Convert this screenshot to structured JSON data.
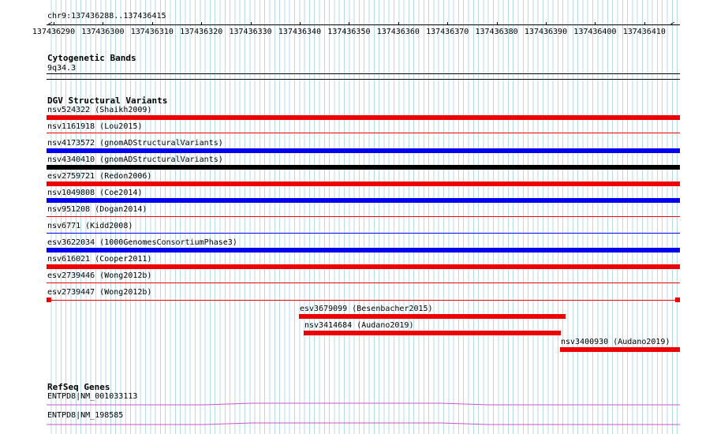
{
  "colors": {
    "red": "#ee0000",
    "blue": "#0000ee",
    "black": "#000000",
    "gene": "#cc55cc",
    "grid": "#b7dbe7"
  },
  "ruler": {
    "location": "chr9:137436288..137436415",
    "ticks": [
      "137436290",
      "137436300",
      "137436310",
      "137436320",
      "137436330",
      "137436340",
      "137436350",
      "137436360",
      "137436370",
      "137436380",
      "137436390",
      "137436400",
      "137436410"
    ],
    "arrow_glyph": "<"
  },
  "cytoband": {
    "title": "Cytogenetic Bands",
    "band": "9q34.3"
  },
  "dgv": {
    "title": "DGV Structural Variants",
    "variants": [
      {
        "label": "nsv524322 (Shaikh2009)",
        "color": "red",
        "style": "bar"
      },
      {
        "label": "nsv1161918 (Lou2015)",
        "color": "red",
        "style": "thin"
      },
      {
        "label": "nsv4173572 (gnomADStructuralVariants)",
        "color": "blue",
        "style": "bar"
      },
      {
        "label": "nsv4340410 (gnomADStructuralVariants)",
        "color": "black",
        "style": "bar"
      },
      {
        "label": "esv2759721 (Redon2006)",
        "color": "red",
        "style": "bar"
      },
      {
        "label": "nsv1049808 (Coe2014)",
        "color": "blue",
        "style": "bar"
      },
      {
        "label": "nsv951208 (Dogan2014)",
        "color": "red",
        "style": "thin"
      },
      {
        "label": "nsv6771 (Kidd2008)",
        "color": "blue",
        "style": "thin"
      },
      {
        "label": "esv3622034 (1000GenomesConsortiumPhase3)",
        "color": "blue",
        "style": "bar"
      },
      {
        "label": "nsv616021 (Cooper2011)",
        "color": "red",
        "style": "bar"
      },
      {
        "label": "esv2739446 (Wong2012b)",
        "color": "red",
        "style": "thin"
      },
      {
        "label": "esv2739447 (Wong2012b)",
        "color": "red",
        "style": "ends"
      },
      {
        "label": "esv3679099 (Besenbacher2015)",
        "color": "red",
        "style": "bar"
      },
      {
        "label": "nsv3414684 (Audano2019)",
        "color": "red",
        "style": "bar"
      },
      {
        "label": "nsv3400930 (Audano2019)",
        "color": "red",
        "style": "bar"
      }
    ]
  },
  "refseq": {
    "title": "RefSeq Genes",
    "genes": [
      {
        "label": "ENTPD8|NM_001033113"
      },
      {
        "label": "ENTPD8|NM_198585"
      }
    ]
  }
}
